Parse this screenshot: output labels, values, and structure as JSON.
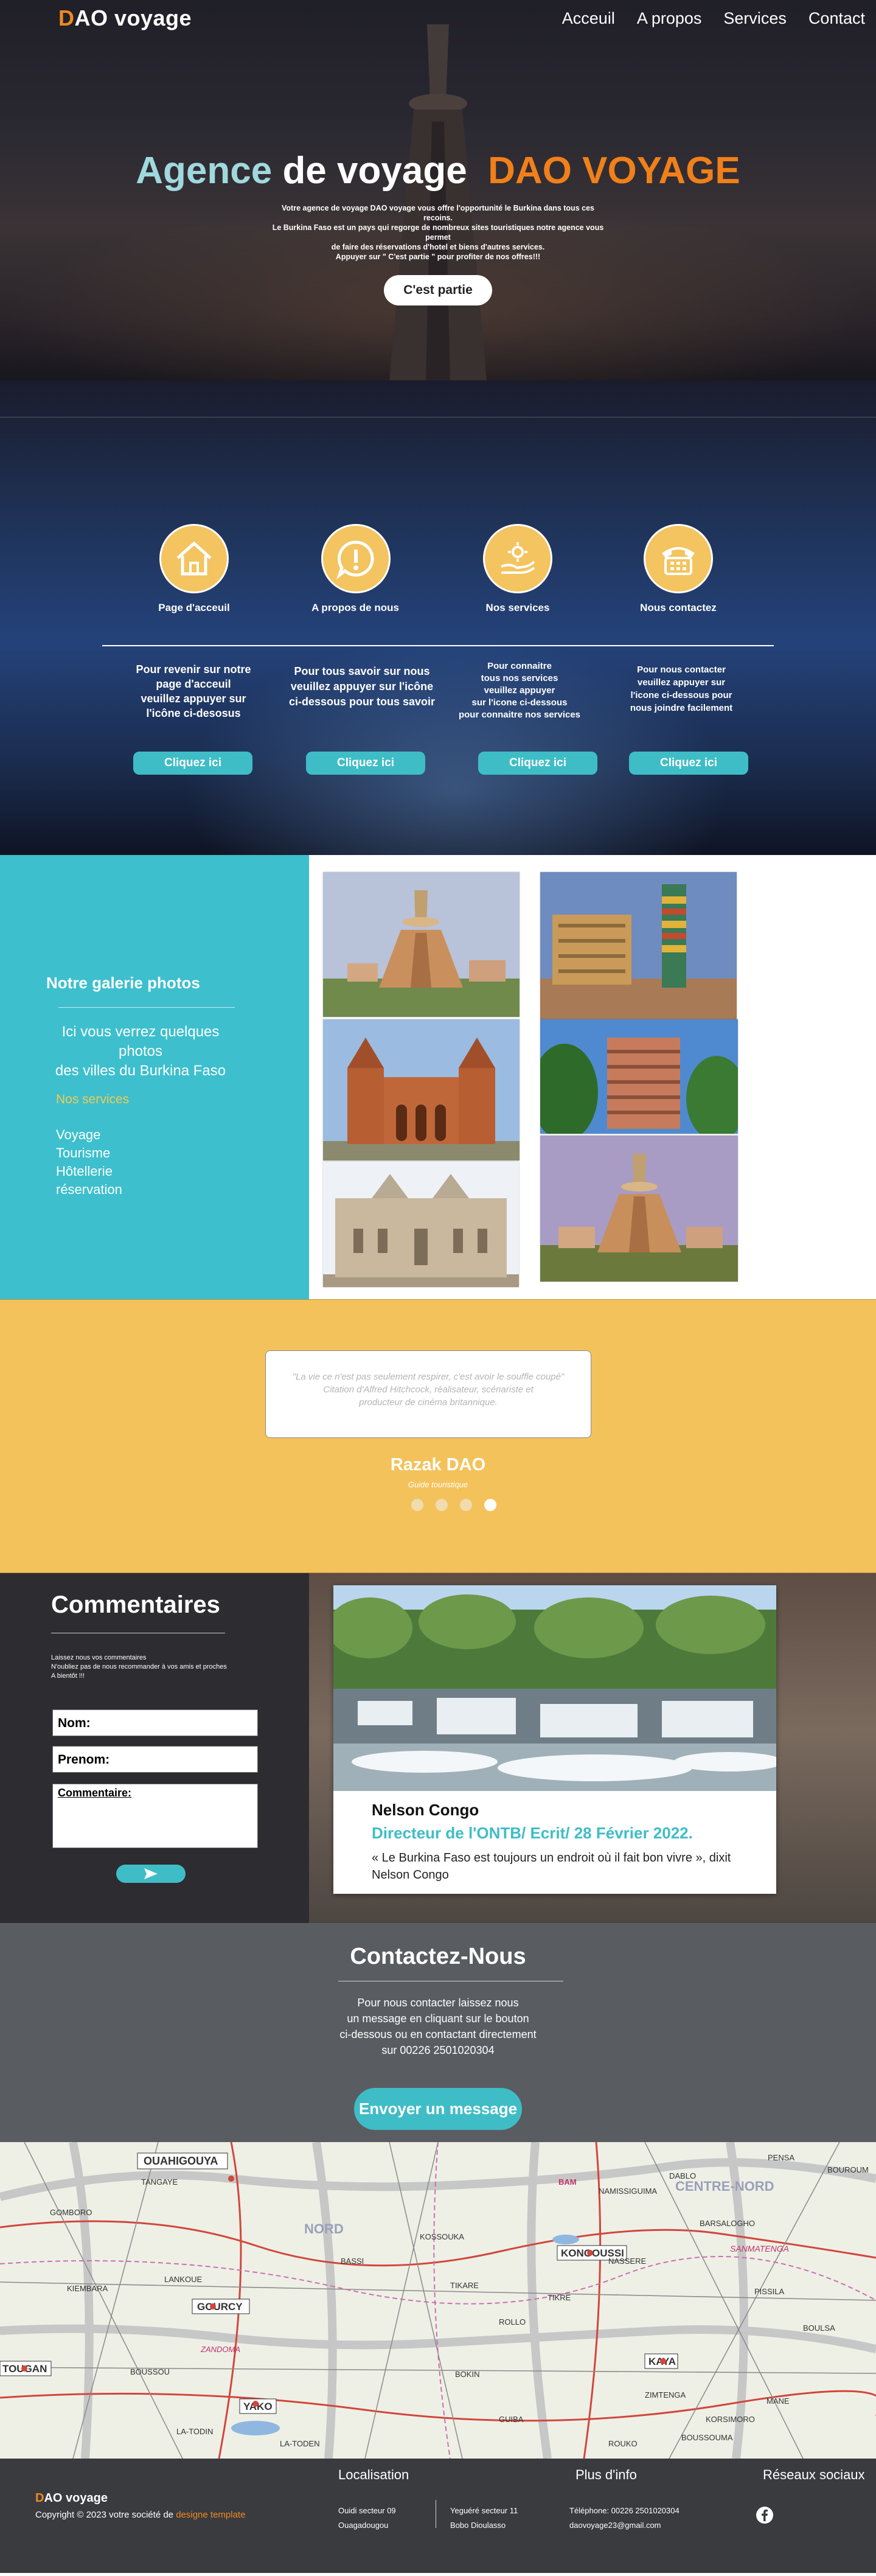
{
  "nav": {
    "logo_first": "D",
    "logo_rest": "AO voyage",
    "items": [
      "Acceuil",
      "A propos",
      "Services",
      "Contact"
    ]
  },
  "hero": {
    "title_part1": "Agence",
    "title_part2": "de voyage",
    "title_part3": "DAO VOYAGE",
    "description": "Votre agence de voyage DAO voyage vous offre l'opportunité le Burkina  dans tous ces recoins.\nLe Burkina Faso est un pays qui regorge de nombreux sites touristiques notre agence vous permet\nde faire des réservations d'hotel et biens d'autres services.\nAppuyer sur \" C'est partie \" pour profiter de nos offres!!!",
    "button": "C'est partie"
  },
  "services": {
    "items": [
      {
        "icon": "house-icon",
        "title": "Page d'acceuil",
        "text": "Pour revenir sur notre\npage d'acceuil\nveuillez appuyer sur\nl'icône ci-desosus",
        "button": "Cliquez ici"
      },
      {
        "icon": "alert-icon",
        "title": "A propos de nous",
        "text": "Pour tous savoir sur nous\nveuillez appuyer sur l'icône\nci-dessous pour tous savoir",
        "button": "Cliquez ici"
      },
      {
        "icon": "hand-gear-icon",
        "title": "Nos services",
        "text": "Pour connaitre\ntous nos services\nveuillez appuyer\nsur l'icone ci-dessous\npour connaitre nos services",
        "button": "Cliquez ici"
      },
      {
        "icon": "telephone-icon",
        "title": "Nous contactez",
        "text": "Pour nous contacter\nveuillez appuyer sur\nl'icone ci-dessous pour\nnous joindre facilement",
        "button": "Cliquez ici"
      }
    ]
  },
  "gallery": {
    "title": "Notre galerie photos",
    "subtitle": "Ici vous verrez quelques photos\ndes villes du Burkina Faso",
    "services_heading": "Nos services",
    "services_list": [
      "Voyage",
      "Tourisme",
      "Hôtellerie",
      "réservation"
    ]
  },
  "testimonial": {
    "quote": "\"La vie ce n'est pas seulement respirer, c'est avoir le souffle coupé\"\nCitation d'Alfred Hitchcock, réalisateur, scénariste et\nproducteur de cinéma britannique.",
    "name": "Razak DAO",
    "role": "Guide touristique",
    "active_slide": 4,
    "slide_count": 4
  },
  "comments": {
    "title": "Commentaires",
    "description": "Laissez nous vos  commentaires\nN'oubliez pas de nous recommander à vos amis et proches\nA bientôt !!!",
    "name_label": "Nom:",
    "surname_label": "Prenom:",
    "comment_label": "Commentaire:",
    "send_icon": "send-icon",
    "card": {
      "name": "Nelson Congo",
      "role": "Directeur de l'ONTB/ Ecrit/ 28 Février 2022.",
      "text": "« Le Burkina Faso est toujours un endroit où il fait bon vivre », dixit Nelson Congo"
    }
  },
  "contact": {
    "title": "Contactez-Nous",
    "text": "Pour nous contacter laissez nous\nun message en cliquant sur le bouton\nci-dessous ou en contactant directement\nsur 00226 2501020304",
    "button": "Envoyer un message"
  },
  "map": {
    "labels": [
      "OUAHIGOUYA",
      "GOURCY",
      "TOUGAN",
      "YAKO",
      "KONGOUSSI",
      "KAYA",
      "NORD",
      "CENTRE-NORD",
      "SANMATENGA",
      "TANGAYE",
      "NAMISSIGUIMA",
      "BARSALOGHO",
      "PENSA",
      "BOUROUM",
      "GOMBORO",
      "KIEMBARA",
      "LANKOUE",
      "BOUSSOU",
      "BOKIN",
      "BOULSA",
      "LA-TODIN",
      "BAM",
      "ZANDOMA",
      "PISSILA",
      "TIKARE",
      "ROLLO",
      "DABLO",
      "KOSSOUKA",
      "BASSI",
      "LA-TODEN",
      "GUIBA",
      "ROUKO",
      "KORSIMORO",
      "ZIMTENGA",
      "MANE",
      "TIKRE",
      "BOUSSOUMA",
      "NASSERE"
    ]
  },
  "footer": {
    "brand_first": "D",
    "brand_rest": "AO voyage",
    "copyright_prefix": "Copyright © 2023 votre société de ",
    "copyright_link": "designe template",
    "localisation_head": "Localisation",
    "loc1": "Ouidi secteur 09\nOuagadougou",
    "loc2": "Yeguéré secteur 11\nBobo Dioulasso",
    "info_head": "Plus d'info",
    "info": "Téléphone: 00226 2501020304\ndaovoyage23@gmail.com",
    "social_head": "Réseaux sociaux",
    "social_icon": "facebook-icon"
  },
  "colors": {
    "accent_teal": "#3fbdc6",
    "accent_orange": "#f08a1e",
    "accent_yellow": "#f4c25b"
  }
}
